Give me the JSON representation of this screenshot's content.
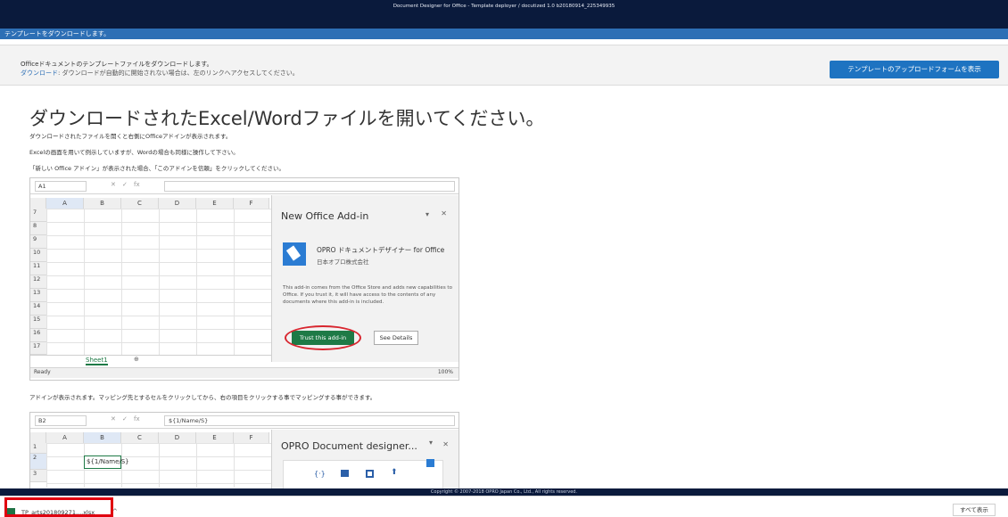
{
  "window": {
    "title": "Document Designer for Office - Template deployer / docutized 1.0 b20180914_225349935"
  },
  "subbar": {
    "label": "テンプレートをダウンロードします。"
  },
  "info": {
    "line1": "Officeドキュメントのテンプレートファイルをダウンロードします。",
    "link": "ダウンロード",
    "line2": ": ダウンロードが自動的に開始されない場合は、左のリンクへアクセスしてください。"
  },
  "upload_button": "テンプレートのアップロードフォームを表示",
  "main": {
    "heading": "ダウンロードされたExcel/Wordファイルを開いてください。",
    "para1": "ダウンロードされたファイルを開くと右側にOfficeアドインが表示されます。",
    "para2": "Excelの画面を用いて例示していますが、Wordの場合も同様に操作して下さい。",
    "para3": "「新しい Office アドイン」が表示された場合、「このアドインを信頼」をクリックしてください。",
    "para4": "アドインが表示されます。マッピング先とするセルをクリックしてから、右の項目をクリックする事でマッピングする事ができます。"
  },
  "excel1": {
    "namebox": "A1",
    "fx_icon": "fx",
    "columns": [
      "A",
      "B",
      "C",
      "D",
      "E",
      "F"
    ],
    "rows": [
      "7",
      "8",
      "9",
      "10",
      "11",
      "12",
      "13",
      "14",
      "15",
      "16",
      "17"
    ],
    "sheet_tab": "Sheet1",
    "add_sheet": "⊕",
    "status": "Ready",
    "zoom": "100%",
    "addin_pane": {
      "title": "New Office Add-in",
      "addin_name": "OPRO ドキュメントデザイナー for Office",
      "publisher": "日本オプロ株式会社",
      "description": "This add-in comes from the Office Store and adds new capabilities to Office. If you trust it, it will have access to the contents of any documents where this add-in is included.",
      "trust_label": "Trust this add-in",
      "details_label": "See Details"
    }
  },
  "excel2": {
    "namebox": "B2",
    "fx_icon": "fx",
    "formula": "${1/Name/S}",
    "columns": [
      "A",
      "B",
      "C",
      "D",
      "E",
      "F"
    ],
    "rows": [
      "1",
      "2",
      "3"
    ],
    "cell_b2": "${1/Name/S}",
    "pane_title": "OPRO Document designer..."
  },
  "footer": {
    "copyright": "Copyright © 2007-2018 OPRO Japan Co., Ltd., All rights reserved."
  },
  "downloads": {
    "file_name": "TP_arts201809271....xlsx",
    "caret": "^",
    "show_all": "すべて表示"
  },
  "colors": {
    "accent": "#1e73c1",
    "titlebar": "#0a1a3c",
    "trust_green": "#1e7a46",
    "highlight_red": "#e0000f"
  }
}
